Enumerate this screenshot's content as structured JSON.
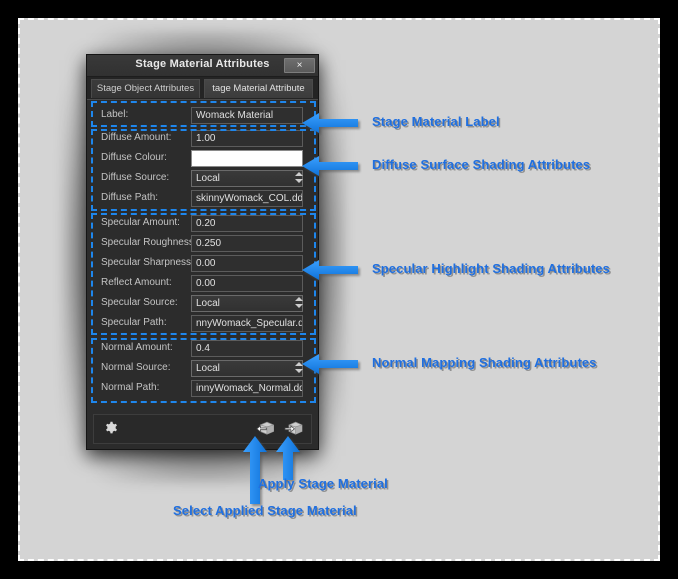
{
  "window": {
    "title": "Stage Material Attributes",
    "close_label": "×",
    "tabs": [
      {
        "label": "Stage Object Attributes",
        "active": false
      },
      {
        "label": "tage Material Attribute",
        "active": true
      }
    ]
  },
  "groups": {
    "label_group": {
      "rows": [
        {
          "label": "Label:",
          "value": "Womack Material",
          "type": "text"
        }
      ]
    },
    "diffuse_group": {
      "rows": [
        {
          "label": "Diffuse Amount:",
          "value": "1.00",
          "type": "text"
        },
        {
          "label": "Diffuse Colour:",
          "value": "",
          "type": "swatch",
          "color": "#ffffff"
        },
        {
          "label": "Diffuse Source:",
          "value": "Local",
          "type": "combo"
        },
        {
          "label": "Diffuse Path:",
          "value": "skinnyWomack_COL.dds",
          "type": "text"
        }
      ]
    },
    "specular_group": {
      "rows": [
        {
          "label": "Specular Amount:",
          "value": "0.20",
          "type": "text"
        },
        {
          "label": "Specular Roughness",
          "value": "0.250",
          "type": "text"
        },
        {
          "label": "Specular Sharpness:",
          "value": "0.00",
          "type": "text"
        },
        {
          "label": "Reflect Amount:",
          "value": "0.00",
          "type": "text"
        },
        {
          "label": "Specular Source:",
          "value": "Local",
          "type": "combo"
        },
        {
          "label": "Specular Path:",
          "value": "nnyWomack_Specular.dds",
          "type": "text"
        }
      ]
    },
    "normal_group": {
      "rows": [
        {
          "label": "Normal Amount:",
          "value": "0.4",
          "type": "text"
        },
        {
          "label": "Normal Source:",
          "value": "Local",
          "type": "combo"
        },
        {
          "label": "Normal Path:",
          "value": "innyWomack_Normal.dds",
          "type": "text"
        }
      ]
    }
  },
  "toolbar": {
    "settings_icon": "gear-icon",
    "select_icon": "cube-arrow-left-icon",
    "apply_icon": "cube-arrow-right-icon"
  },
  "annotations": {
    "stage_material_label": "Stage Material Label",
    "diffuse": "Diffuse Surface Shading Attributes",
    "specular": "Specular Highlight Shading Attributes",
    "normal": "Normal Mapping Shading Attributes",
    "apply_stage_material": "Apply Stage Material",
    "select_applied_stage_material": "Select Applied Stage Material"
  },
  "colors": {
    "annotation_blue": "#1f6fe0",
    "arrow_blue": "#1b8cf2",
    "dash_blue": "#1e86ec",
    "page_background": "#d4d4d4",
    "dialog_background": "#2b2b2b"
  }
}
